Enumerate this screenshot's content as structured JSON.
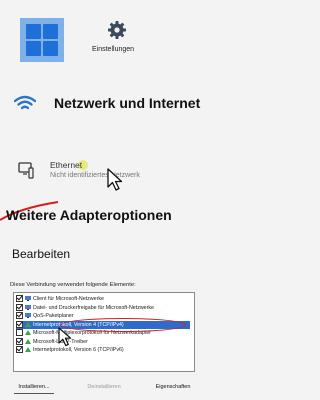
{
  "top": {
    "settings_label": "Einstellungen"
  },
  "network": {
    "title": "Netzwerk und Internet"
  },
  "ethernet": {
    "label": "Ethernet",
    "sub": "Nicht identifiziertes Netzwerk"
  },
  "adapter": {
    "title": "Weitere Adapteroptionen",
    "edit": "Bearbeiten"
  },
  "dialog": {
    "list_label": "Diese Verbindung verwendet folgende Elemente:",
    "items": [
      {
        "label": "Client für Microsoft-Netzwerke",
        "checked": true,
        "selected": false
      },
      {
        "label": "Datei- und Druckerfreigabe für Microsoft-Netzwerke",
        "checked": true,
        "selected": false
      },
      {
        "label": "QoS-Paketplaner",
        "checked": true,
        "selected": false
      },
      {
        "label": "Internetprotokoll, Version 4 (TCP/IPv4)",
        "checked": true,
        "selected": true
      },
      {
        "label": "Microsoft-Multiplexorprotokoll für Netzwerkadapter",
        "checked": false,
        "selected": false
      },
      {
        "label": "Microsoft-LLDP-Treiber",
        "checked": true,
        "selected": false
      },
      {
        "label": "Internetprotokoll, Version 6 (TCP/IPv6)",
        "checked": true,
        "selected": false
      }
    ],
    "buttons": {
      "install": "Installieren...",
      "uninstall": "Deinstallieren",
      "properties": "Eigenschaften"
    }
  },
  "colors": {
    "accent": "#1f6fd8",
    "highlight": "#d71c1c",
    "selection": "#2d6cc9"
  }
}
